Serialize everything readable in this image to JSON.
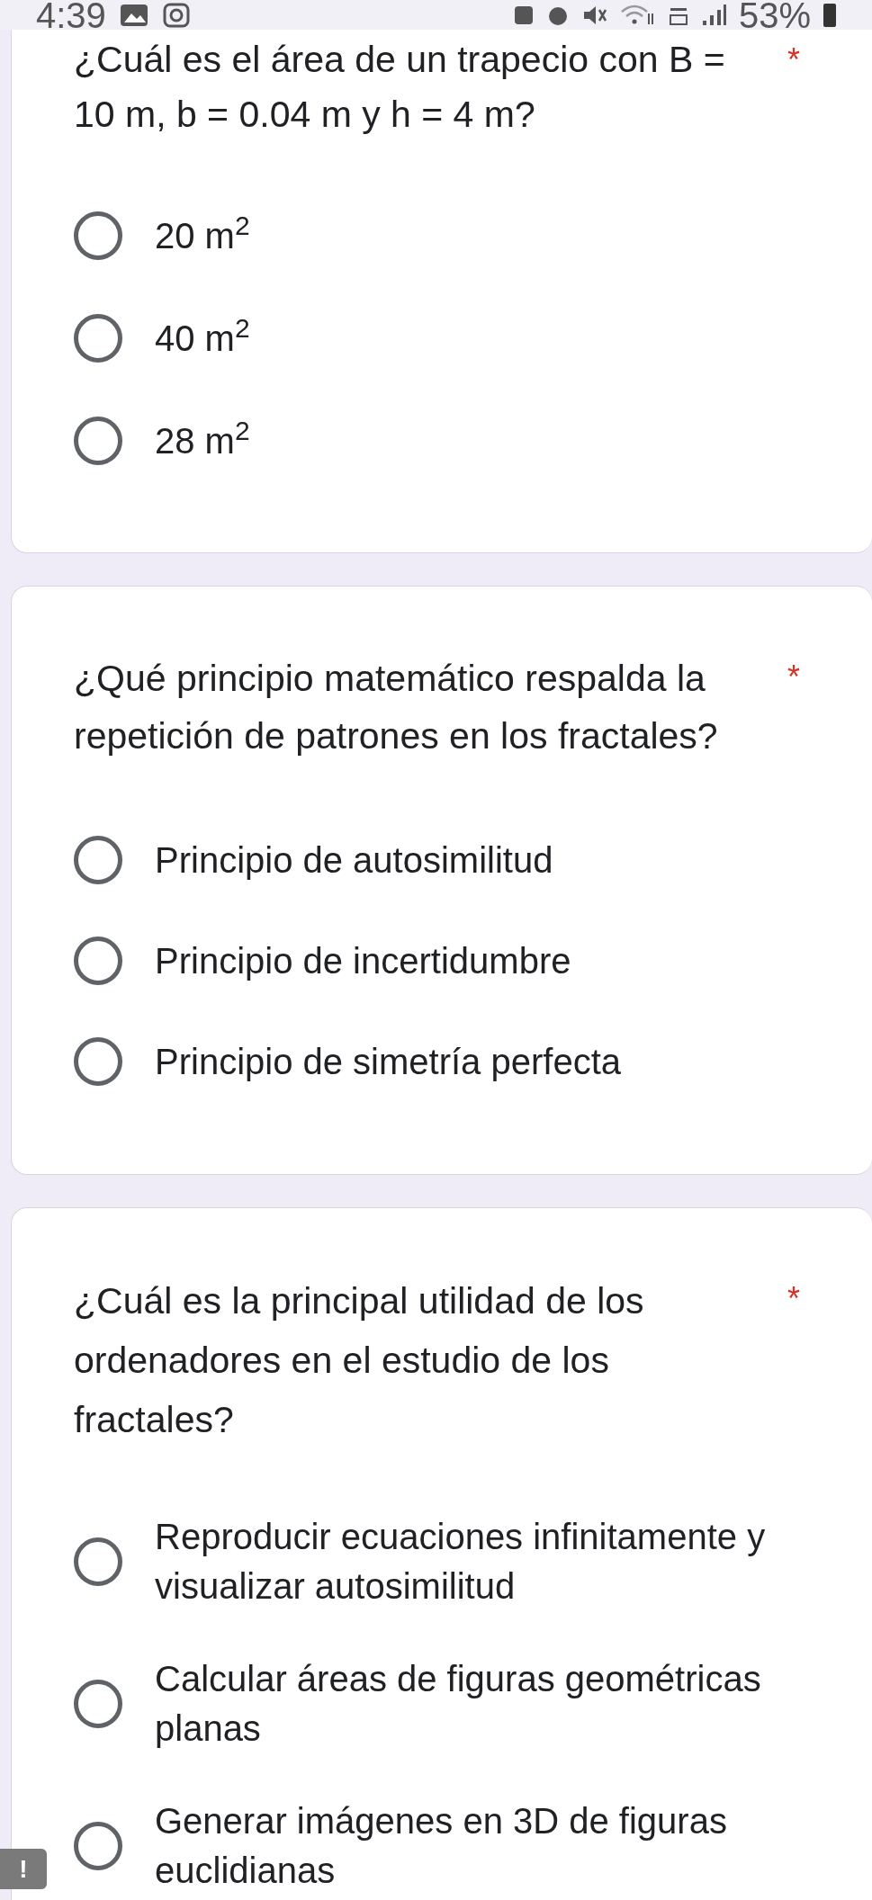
{
  "status_bar": {
    "time": "4:39",
    "battery": "53%"
  },
  "questions": [
    {
      "title_lines": [
        "¿Cuál es el área de un trapecio con B =",
        "10 m, b = 0.04 m y h = 4 m?"
      ],
      "required_mark": "*",
      "options": [
        {
          "lines": [
            "20 m$^{2}$"
          ],
          "selected": false
        },
        {
          "lines": [
            "40 m$^{2}$"
          ],
          "selected": false
        },
        {
          "lines": [
            "28 m$^{2}$"
          ],
          "selected": false
        }
      ]
    },
    {
      "title_lines": [
        "¿Qué principio matemático respalda la",
        "repetición de patrones en los fractales?"
      ],
      "required_mark": "*",
      "options": [
        {
          "lines": [
            "Principio de autosimilitud"
          ],
          "selected": false
        },
        {
          "lines": [
            "Principio de incertidumbre"
          ],
          "selected": false
        },
        {
          "lines": [
            "Principio de simetría perfecta"
          ],
          "selected": false
        }
      ]
    },
    {
      "title_lines": [
        "¿Cuál es la principal utilidad de los",
        "ordenadores en el estudio de los",
        "fractales?"
      ],
      "required_mark": "*",
      "options": [
        {
          "lines": [
            "Reproducir ecuaciones infinitamente y",
            "visualizar autosimilitud"
          ],
          "selected": false
        },
        {
          "lines": [
            "Calcular áreas de figuras geométricas",
            "planas"
          ],
          "selected": false
        },
        {
          "lines": [
            "Generar imágenes en 3D de figuras",
            "euclidianas"
          ],
          "selected": false
        }
      ]
    }
  ],
  "feedback_badge": {
    "label": "!"
  }
}
